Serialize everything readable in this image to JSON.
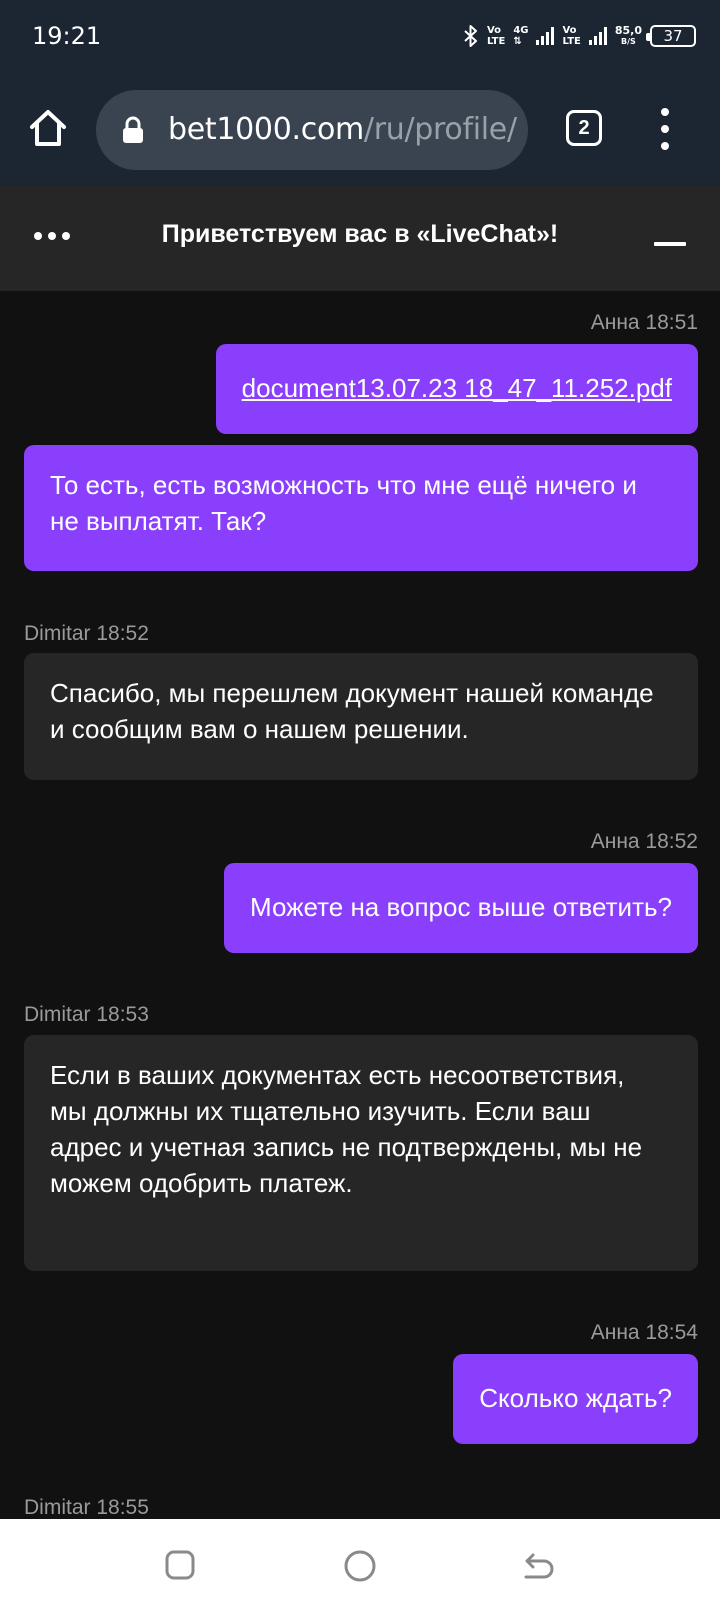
{
  "status_bar": {
    "time": "19:21",
    "network1": [
      "Vo",
      "LTE"
    ],
    "network_4g": [
      "4G",
      "⇅"
    ],
    "network2": [
      "Vo",
      "LTE"
    ],
    "speed_value": "85,0",
    "speed_unit": "B/S",
    "battery": "37"
  },
  "browser": {
    "url_host": "bet1000.com",
    "url_path": "/ru/profile/",
    "tab_count": "2"
  },
  "chat": {
    "title": "Приветствуем вас в «LiveChat»!",
    "messages": [
      {
        "meta": "Анна 18:51",
        "text": "document13.07.23 18_47_11.252.pdf"
      },
      {
        "text": "То есть, есть возможность что мне ещё ничего и не выплатят. Так?"
      },
      {
        "meta": "Dimitar 18:52",
        "text": "Спасибо, мы перешлем документ нашей команде и сообщим вам о нашем решении."
      },
      {
        "meta": "Анна 18:52",
        "text": "Можете на вопрос выше ответить?"
      },
      {
        "meta": "Dimitar 18:53",
        "text": "Если в ваших документах есть несоответствия, мы должны их тщательно изучить. Если ваш адрес и учетная запись не подтверждены, мы не можем одобрить платеж."
      },
      {
        "meta": "Анна 18:54",
        "text": "Сколько ждать?"
      },
      {
        "meta": "Dimitar 18:55"
      }
    ]
  },
  "colors": {
    "outgoing_bubble": "#8a3ffc",
    "incoming_bubble": "#262626",
    "background": "#111111"
  },
  "icons": [
    "bluetooth-icon",
    "home-icon",
    "lock-icon",
    "more-dots-icon",
    "minimize-icon",
    "recents-icon",
    "home-circle-icon",
    "back-icon"
  ]
}
